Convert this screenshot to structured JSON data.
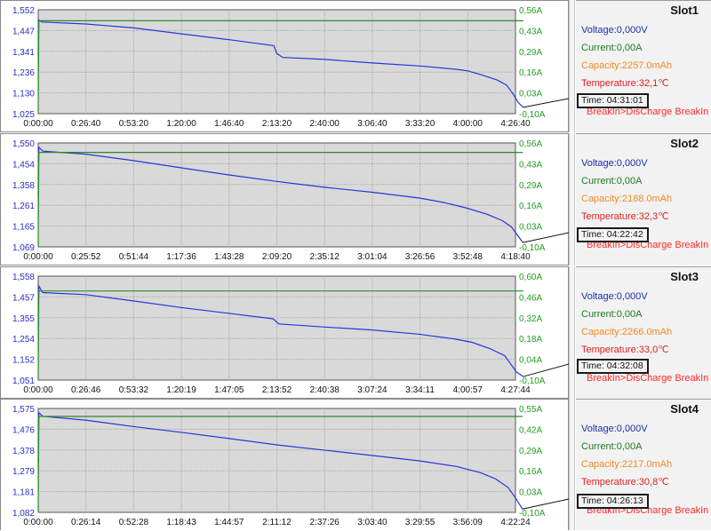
{
  "slots": [
    {
      "title": "Slot1",
      "voltage_label": "Voltage:",
      "voltage_value": "0,000V",
      "current_label": "Current:",
      "current_value": "0,00A",
      "capacity_label": "Capacity:",
      "capacity_value": "2257.0mAh",
      "temperature_label": "Temperature:",
      "temperature_value": "32,1℃",
      "time_label": "Time:",
      "time_value": "04:31:01",
      "mode_text": "BreakIn>DisCharge BreakIn"
    },
    {
      "title": "Slot2",
      "voltage_label": "Voltage:",
      "voltage_value": "0,000V",
      "current_label": "Current:",
      "current_value": "0,00A",
      "capacity_label": "Capacity:",
      "capacity_value": "2188.0mAh",
      "temperature_label": "Temperature:",
      "temperature_value": "32,3℃",
      "time_label": "Time:",
      "time_value": "04:22:42",
      "mode_text": "BreakIn>DisCharge BreakIn"
    },
    {
      "title": "Slot3",
      "voltage_label": "Voltage:",
      "voltage_value": "0,000V",
      "current_label": "Current:",
      "current_value": "0,00A",
      "capacity_label": "Capacity:",
      "capacity_value": "2266.0mAh",
      "temperature_label": "Temperature:",
      "temperature_value": "33,0℃",
      "time_label": "Time:",
      "time_value": "04:32:08",
      "mode_text": "BreakIn>DisCharge BreakIn"
    },
    {
      "title": "Slot4",
      "voltage_label": "Voltage:",
      "voltage_value": "0,000V",
      "current_label": "Current:",
      "current_value": "0,00A",
      "capacity_label": "Capacity:",
      "capacity_value": "2217.0mAh",
      "temperature_label": "Temperature:",
      "temperature_value": "30,8℃",
      "time_label": "Time:",
      "time_value": "04:26:13",
      "mode_text": "BreakIn>DisCharge BreakIn"
    }
  ],
  "colors": {
    "voltage": "#2a35d8",
    "current": "#2b8a2b",
    "capacity": "#f08a22",
    "temperature": "#e02020",
    "plot_bg": "#d9d9d9",
    "grid": "#a8a8a8",
    "left_axis_text": "#2a2fc0",
    "right_axis_text": "#20a020"
  },
  "chart_data": [
    {
      "type": "line",
      "x_unit": "h:mm:ss",
      "left_axis_ticks": [
        "1,552",
        "1,447",
        "1,341",
        "1,236",
        "1,130",
        "1,025"
      ],
      "right_axis_ticks": [
        "0,56A",
        "0,43A",
        "0,29A",
        "0,16A",
        "0,03A",
        "-0,10A"
      ],
      "x_ticks": [
        "0:00:00",
        "0:26:40",
        "0:53:20",
        "1:20:00",
        "1:46:40",
        "2:13:20",
        "2:40:00",
        "3:06:40",
        "3:33:20",
        "4:00:00",
        "4:26:40"
      ],
      "xlim": [
        0,
        16000
      ],
      "ylim_left": [
        1.025,
        1.552
      ],
      "ylim_right": [
        -0.1,
        0.56
      ],
      "end_x": 16261,
      "series": [
        {
          "axis": "left",
          "x": [
            0,
            20,
            120,
            1600,
            3200,
            4800,
            6400,
            7900,
            8000,
            8200,
            9600,
            11200,
            12800,
            14000,
            14400,
            14900,
            15400,
            15700,
            15900,
            16100,
            16261
          ],
          "y": [
            1.32,
            1.5,
            1.49,
            1.48,
            1.46,
            1.43,
            1.4,
            1.37,
            1.33,
            1.31,
            1.3,
            1.282,
            1.267,
            1.25,
            1.242,
            1.22,
            1.195,
            1.17,
            1.13,
            1.08,
            1.057
          ]
        },
        {
          "axis": "right",
          "x": [
            0,
            20,
            200,
            16261
          ],
          "y": [
            -0.1,
            0.49,
            0.49,
            0.49
          ]
        }
      ]
    },
    {
      "type": "line",
      "x_unit": "h:mm:ss",
      "left_axis_ticks": [
        "1,550",
        "1,454",
        "1,358",
        "1,261",
        "1,165",
        "1,069"
      ],
      "right_axis_ticks": [
        "0,56A",
        "0,43A",
        "0,29A",
        "0,16A",
        "0,03A",
        "-0,10A"
      ],
      "x_ticks": [
        "0:00:00",
        "0:25:52",
        "0:51:44",
        "1:17:36",
        "1:43:28",
        "2:09:20",
        "2:35:12",
        "3:01:04",
        "3:26:56",
        "3:52:48",
        "4:18:40"
      ],
      "xlim": [
        0,
        15520
      ],
      "ylim_left": [
        1.069,
        1.55
      ],
      "ylim_right": [
        -0.1,
        0.56
      ],
      "end_x": 15762,
      "series": [
        {
          "axis": "left",
          "x": [
            0,
            20,
            150,
            1550,
            3100,
            4650,
            6200,
            7760,
            9300,
            10860,
            12400,
            13200,
            13900,
            14600,
            15100,
            15400,
            15600,
            15762
          ],
          "y": [
            1.3,
            1.53,
            1.512,
            1.498,
            1.468,
            1.435,
            1.402,
            1.372,
            1.345,
            1.322,
            1.295,
            1.274,
            1.25,
            1.22,
            1.19,
            1.16,
            1.12,
            1.089
          ]
        },
        {
          "axis": "right",
          "x": [
            0,
            20,
            200,
            15762
          ],
          "y": [
            -0.1,
            0.5,
            0.5,
            0.5
          ]
        }
      ]
    },
    {
      "type": "line",
      "x_unit": "h:mm:ss",
      "left_axis_ticks": [
        "1,558",
        "1,457",
        "1,355",
        "1,254",
        "1,152",
        "1,051"
      ],
      "right_axis_ticks": [
        "0,60A",
        "0,46A",
        "0,32A",
        "0,18A",
        "0,04A",
        "-0,10A"
      ],
      "x_ticks": [
        "0:00:00",
        "0:26:46",
        "0:53:32",
        "1:20:19",
        "1:47:05",
        "2:13:52",
        "2:40:38",
        "3:07:24",
        "3:34:11",
        "4:00:57",
        "4:27:44"
      ],
      "xlim": [
        0,
        16064
      ],
      "ylim_left": [
        1.051,
        1.558
      ],
      "ylim_right": [
        -0.1,
        0.6
      ],
      "end_x": 16328,
      "series": [
        {
          "axis": "left",
          "x": [
            0,
            20,
            150,
            1600,
            3200,
            4800,
            6400,
            7900,
            8100,
            9600,
            11200,
            12800,
            14000,
            14600,
            15200,
            15700,
            15900,
            16100,
            16328
          ],
          "y": [
            1.3,
            1.51,
            1.478,
            1.468,
            1.437,
            1.405,
            1.377,
            1.35,
            1.325,
            1.31,
            1.296,
            1.275,
            1.252,
            1.235,
            1.205,
            1.17,
            1.13,
            1.09,
            1.068
          ]
        },
        {
          "axis": "right",
          "x": [
            0,
            20,
            200,
            16328
          ],
          "y": [
            -0.1,
            0.5,
            0.5,
            0.5
          ]
        }
      ]
    },
    {
      "type": "line",
      "x_unit": "h:mm:ss",
      "left_axis_ticks": [
        "1,575",
        "1,476",
        "1,378",
        "1,279",
        "1,181",
        "1,082"
      ],
      "right_axis_ticks": [
        "0,55A",
        "0,42A",
        "0,29A",
        "0,16A",
        "0,03A",
        "-0,10A"
      ],
      "x_ticks": [
        "0:00:00",
        "0:26:14",
        "0:52:28",
        "1:18:43",
        "1:44:57",
        "2:11:12",
        "2:37:26",
        "3:03:40",
        "3:29:55",
        "3:56:09",
        "4:22:24"
      ],
      "xlim": [
        0,
        15744
      ],
      "ylim_left": [
        1.082,
        1.575
      ],
      "ylim_right": [
        -0.1,
        0.55
      ],
      "end_x": 15973,
      "series": [
        {
          "axis": "left",
          "x": [
            0,
            20,
            150,
            1550,
            3100,
            4700,
            6300,
            7900,
            9400,
            11000,
            12600,
            13800,
            14600,
            15100,
            15500,
            15750,
            15973
          ],
          "y": [
            1.32,
            1.555,
            1.538,
            1.52,
            1.49,
            1.462,
            1.432,
            1.402,
            1.378,
            1.352,
            1.326,
            1.3,
            1.27,
            1.24,
            1.2,
            1.15,
            1.098
          ]
        },
        {
          "axis": "right",
          "x": [
            0,
            20,
            200,
            15973
          ],
          "y": [
            -0.1,
            0.5,
            0.5,
            0.5
          ]
        }
      ]
    }
  ]
}
